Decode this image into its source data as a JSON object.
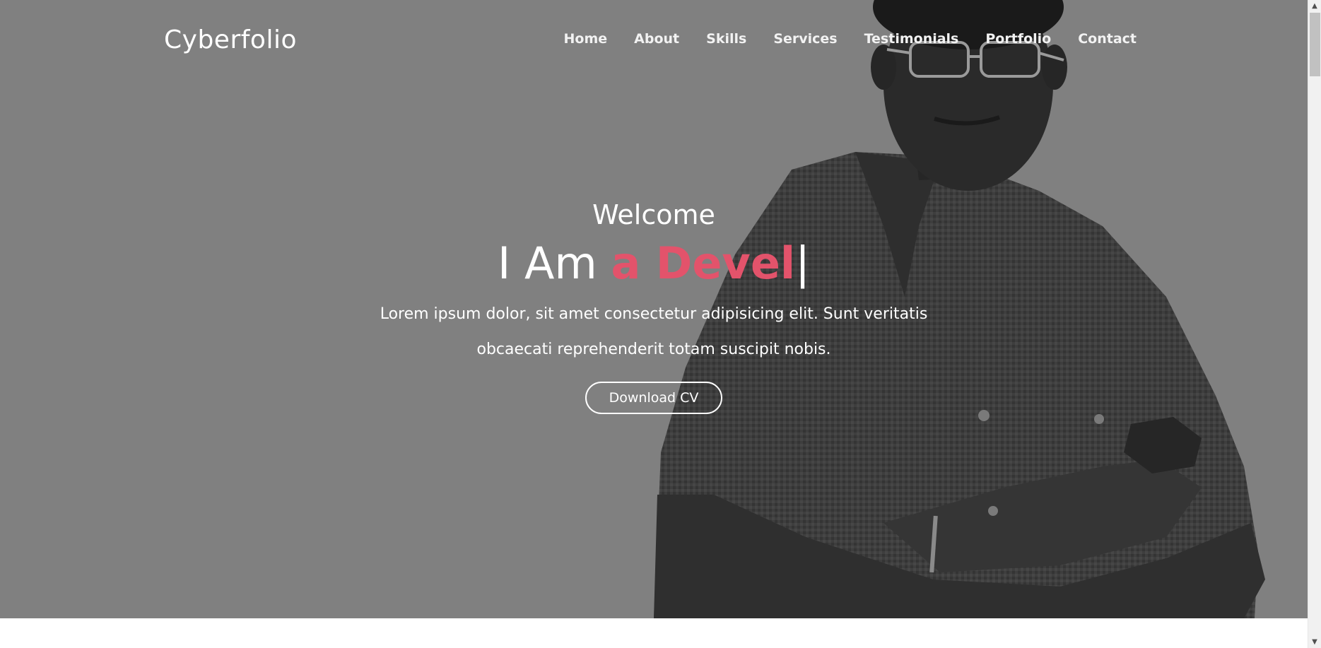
{
  "brand": "Cyberfolio",
  "nav": [
    {
      "label": "Home"
    },
    {
      "label": "About"
    },
    {
      "label": "Skills"
    },
    {
      "label": "Services"
    },
    {
      "label": "Testimonials"
    },
    {
      "label": "Portfolio"
    },
    {
      "label": "Contact"
    }
  ],
  "hero": {
    "welcome": "Welcome",
    "prefix": "I Am ",
    "typed": "a Devel",
    "caret": "|",
    "description": "Lorem ipsum dolor, sit amet consectetur adipisicing elit. Sunt veritatis obcaecati reprehenderit totam suscipit nobis.",
    "button": "Download CV"
  },
  "colors": {
    "accent": "#e3536b",
    "hero_overlay": "#808080"
  },
  "icons": {
    "scroll_up": "chevron-up-icon",
    "scroll_down": "chevron-down-icon"
  }
}
